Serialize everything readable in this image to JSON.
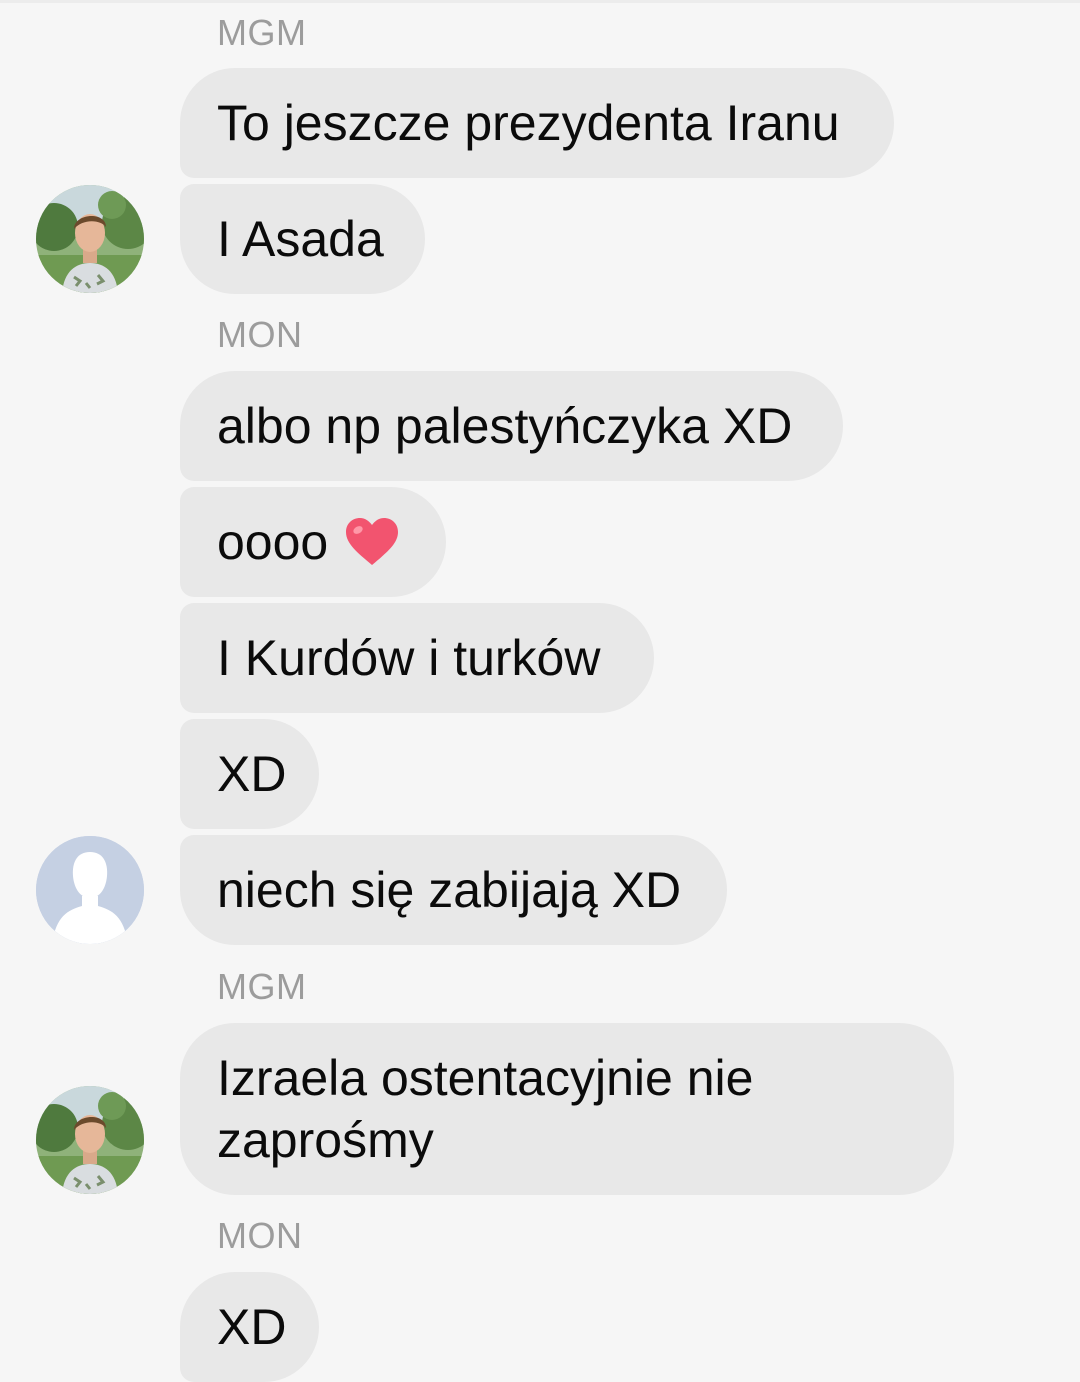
{
  "conversation": {
    "groups": [
      {
        "sender": "MGM",
        "avatar": "user-photo",
        "messages": [
          "To jeszcze prezydenta Iranu",
          "I Asada"
        ]
      },
      {
        "sender": "MON",
        "avatar": "default-silhouette",
        "messages": [
          "albo np palestyńczyka XD",
          "oooo",
          "I Kurdów i turków",
          "XD",
          "niech się zabijają XD"
        ]
      },
      {
        "sender": "MGM",
        "avatar": "user-photo",
        "messages": [
          "Izraela ostentacyjnie nie zaprośmy"
        ]
      },
      {
        "sender": "MON",
        "messages": [
          "XD"
        ]
      }
    ],
    "reaction_icon": "heart-emoji",
    "colors": {
      "background": "#f6f6f6",
      "bubble": "#e8e8e8",
      "sender_label": "#9c9c9c",
      "heart": "#f2546f",
      "silhouette_bg": "#c5d0e3"
    }
  }
}
